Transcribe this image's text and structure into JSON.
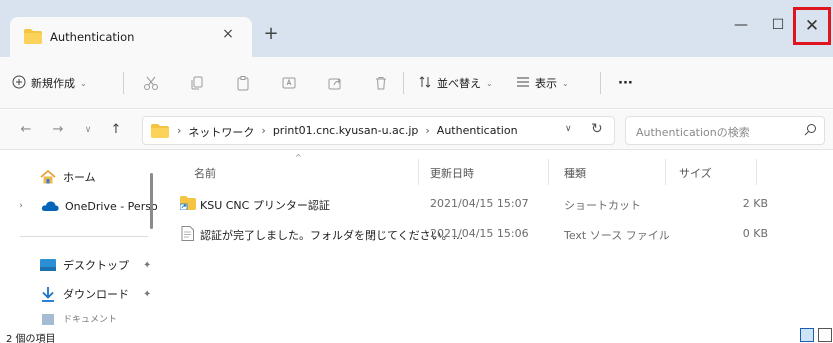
{
  "tab": {
    "title": "Authentication",
    "close_glyph": "×",
    "new_glyph": "+"
  },
  "window": {
    "minimize_glyph": "—",
    "maximize_glyph": "☐",
    "close_glyph": "✕"
  },
  "toolbar": {
    "new_label": "新規作成",
    "sort_label": "並べ替え",
    "view_label": "表示",
    "more_label": "···",
    "chevron": "⌄"
  },
  "address": {
    "crumbs": [
      "ネットワーク",
      "print01.cnc.kyusan-u.ac.jp",
      "Authentication"
    ],
    "separator": "›",
    "search_placeholder": "Authenticationの検索"
  },
  "navpane": {
    "items": [
      {
        "label": "ホーム",
        "icon": "home-icon"
      },
      {
        "label": "OneDrive - Perso",
        "icon": "onedrive-icon"
      },
      {
        "label": "デスクトップ",
        "icon": "desktop-icon"
      },
      {
        "label": "ダウンロード",
        "icon": "download-icon"
      },
      {
        "label": "ドキュメント",
        "icon": "documents-icon"
      }
    ],
    "pin_glyph": "✦"
  },
  "filelist": {
    "columns": {
      "name": "名前",
      "modified": "更新日時",
      "type": "種類",
      "size": "サイズ"
    },
    "rows": [
      {
        "name": "KSU CNC プリンター認証",
        "modified": "2021/04/15 15:07",
        "type": "ショートカット",
        "size": "2 KB",
        "icon": "shortcut-folder-icon"
      },
      {
        "name": "認証が完了しました。フォルダを閉じてください。...",
        "modified": "2021/04/15 15:06",
        "type": "Text ソース ファイル",
        "size": "0 KB",
        "icon": "text-file-icon"
      }
    ]
  },
  "status": {
    "item_count": "2 個の項目"
  },
  "colors": {
    "titlebar": "#d9e3ef",
    "highlight": "#e0141e",
    "folder": "#f5c443"
  }
}
